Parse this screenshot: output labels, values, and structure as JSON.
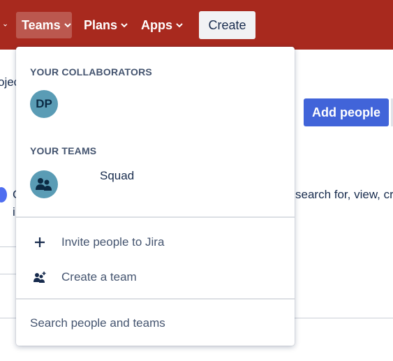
{
  "nav": {
    "teams_label": "Teams",
    "plans_label": "Plans",
    "apps_label": "Apps",
    "create_label": "Create"
  },
  "background": {
    "partial_project_text": "ojec",
    "add_people_label": "Add people",
    "partial_description": "search for, view, cr",
    "partial_char_c": "C",
    "partial_char_i": "i"
  },
  "dropdown": {
    "collaborators_title": "YOUR COLLABORATORS",
    "collaborators": [
      {
        "initials": "DP"
      }
    ],
    "teams_title": "YOUR TEAMS",
    "teams": [
      {
        "name": "Squad"
      }
    ],
    "invite_label": "Invite people to Jira",
    "create_team_label": "Create a team",
    "search_label": "Search people and teams"
  },
  "colors": {
    "topbar": "#a8291e",
    "primary_button": "#4164d9",
    "avatar": "#5a9cb5"
  }
}
